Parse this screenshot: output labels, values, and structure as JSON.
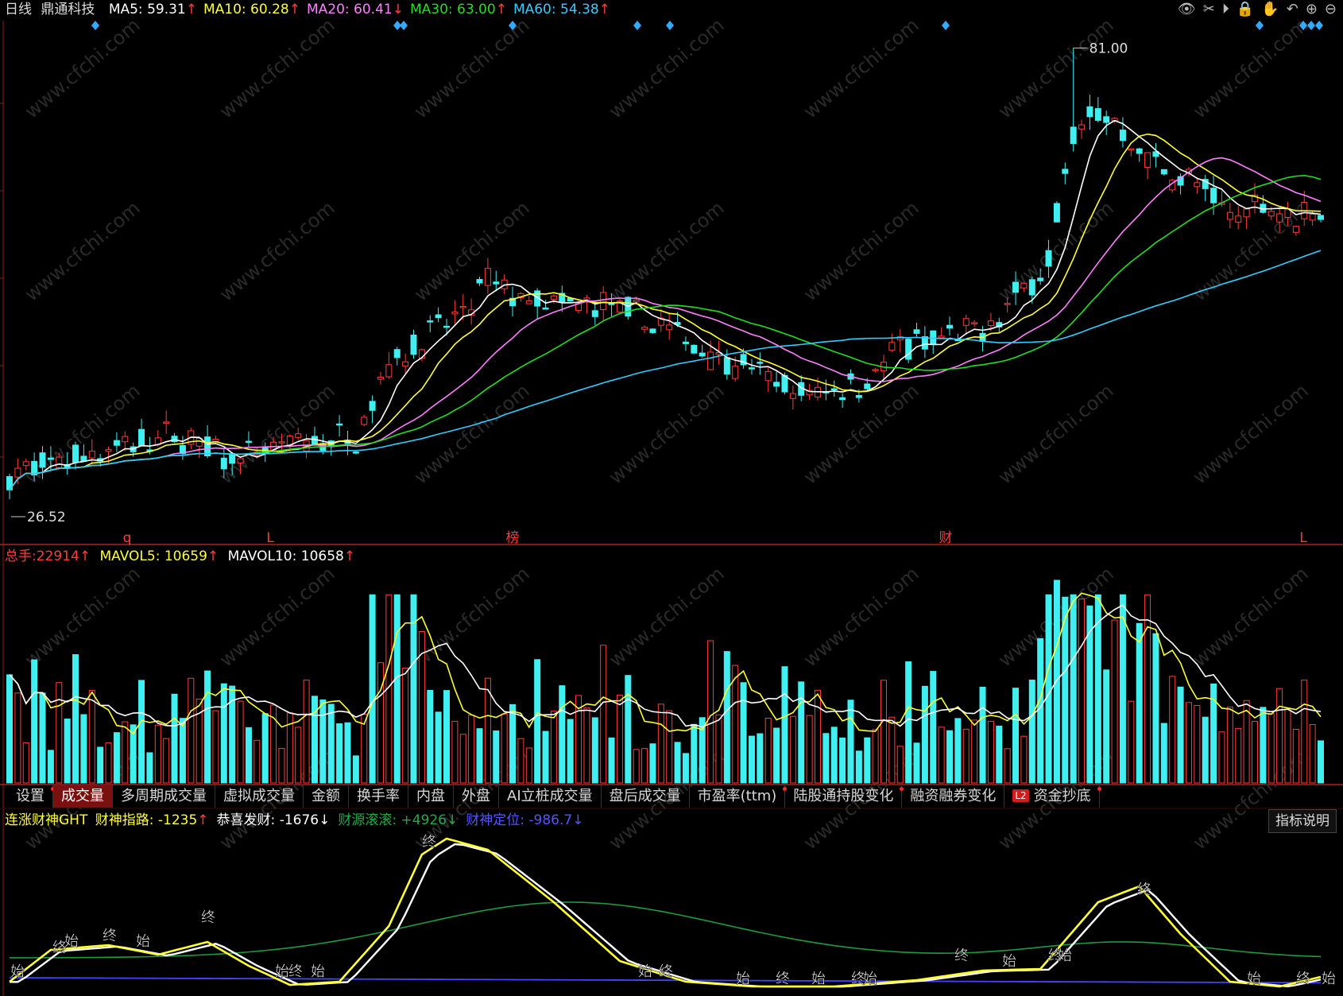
{
  "header": {
    "period": "日线",
    "stock_name": "鼎通科技",
    "ma": [
      {
        "label": "MA5:",
        "value": "59.31",
        "arrow": "↑",
        "color": "#ffffff"
      },
      {
        "label": "MA10:",
        "value": "60.28",
        "arrow": "↑",
        "color": "#ffff33"
      },
      {
        "label": "MA20:",
        "value": "60.41",
        "arrow": "↓",
        "color": "#ff80ff"
      },
      {
        "label": "MA30:",
        "value": "63.00",
        "arrow": "↑",
        "color": "#22dd22"
      },
      {
        "label": "MA60:",
        "value": "54.38",
        "arrow": "↑",
        "color": "#33ccff"
      }
    ]
  },
  "toolbar_icons": [
    "eye-icon",
    "scissors-icon",
    "play-icon",
    "lock-icon",
    "hand-icon",
    "undo-icon",
    "zoom-in-icon",
    "zoom-out-icon"
  ],
  "price_chart": {
    "high_label": "81.00",
    "low_label": "26.52",
    "event_markers": [
      "q",
      "L",
      "榜",
      "财",
      "L"
    ]
  },
  "volume_panel": {
    "total_label": "总手:",
    "total_value": "22914",
    "mavol5_label": "MAVOL5:",
    "mavol5_value": "10659",
    "mavol10_label": "MAVOL10:",
    "mavol10_value": "10658",
    "arrow": "↑"
  },
  "tabs": [
    {
      "label": "设置",
      "active": false,
      "dot": true
    },
    {
      "label": "成交量",
      "active": true,
      "dot": false
    },
    {
      "label": "多周期成交量",
      "active": false,
      "dot": false
    },
    {
      "label": "虚拟成交量",
      "active": false,
      "dot": false
    },
    {
      "label": "金额",
      "active": false,
      "dot": false
    },
    {
      "label": "换手率",
      "active": false,
      "dot": false
    },
    {
      "label": "内盘",
      "active": false,
      "dot": false
    },
    {
      "label": "外盘",
      "active": false,
      "dot": false
    },
    {
      "label": "AI立桩成交量",
      "active": false,
      "dot": false
    },
    {
      "label": "盘后成交量",
      "active": false,
      "dot": false
    },
    {
      "label": "市盈率(ttm)",
      "active": false,
      "dot": true
    },
    {
      "label": "陆股通持股变化",
      "active": false,
      "dot": true
    },
    {
      "label": "融资融券变化",
      "active": false,
      "dot": false
    },
    {
      "label": "资金抄底",
      "active": false,
      "dot": true,
      "badge": "L2"
    }
  ],
  "indicator_panel": {
    "name": "连涨财神GHT",
    "items": [
      {
        "label": "财神指路:",
        "value": "-1235",
        "arrow": "↑",
        "color": "#ffff33"
      },
      {
        "label": "恭喜发财:",
        "value": "-1676",
        "arrow": "↓",
        "color": "#ffffff"
      },
      {
        "label": "财源滚滚:",
        "value": "+4926",
        "arrow": "↓",
        "color": "#22aa44"
      },
      {
        "label": "财神定位:",
        "value": "-986.7",
        "arrow": "↓",
        "color": "#5555ff"
      }
    ],
    "explain_button": "指标说明",
    "signal_start": "始",
    "signal_end": "终"
  },
  "colors": {
    "up": "#ff3b3b",
    "down": "#40f0f0",
    "bg": "#000000"
  },
  "watermark": "www.cfchi.com"
}
